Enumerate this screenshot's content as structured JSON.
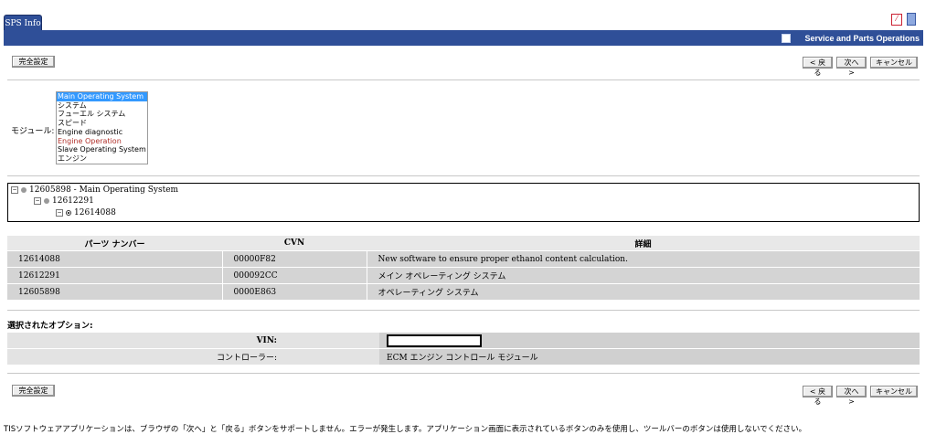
{
  "tab": {
    "label": "SPS Info"
  },
  "banner": {
    "title": "Service and Parts Operations"
  },
  "buttons": {
    "confirm": "完全設定",
    "back": "< 戻る",
    "next": "次へ >",
    "cancel": "キャンセル"
  },
  "module": {
    "label": "モジュール",
    "options": [
      "Main Operating System",
      "システム",
      "フューエル システム",
      "スピード",
      "Engine diagnostic",
      "Engine Operation",
      "Slave Operating System",
      "エンジン"
    ],
    "selected_index": 0
  },
  "tree": {
    "root": "12605898 - Main Operating System",
    "child": "12612291",
    "leaf": "12614088"
  },
  "parts_table": {
    "headers": [
      "パーツ ナンバー",
      "CVN",
      "詳細"
    ],
    "rows": [
      [
        "12614088",
        "00000F82",
        "New software to ensure proper ethanol content calculation."
      ],
      [
        "12612291",
        "000092CC",
        "メイン オペレーティング システム"
      ],
      [
        "12605898",
        "0000E863",
        "オペレーティング システム"
      ]
    ]
  },
  "selected_options": {
    "title": "選択されたオプション:",
    "vin_label": "VIN:",
    "controller_label": "コントローラー:",
    "controller_value": "ECM エンジン コントロール モジュール"
  },
  "footer": "TISソフトウェアアプリケーションは、ブラウザの「次へ」と「戻る」ボタンをサポートしません。エラーが発生します。アプリケーション画面に表示されているボタンのみを使用し、ツールバーのボタンは使用しないでください。"
}
